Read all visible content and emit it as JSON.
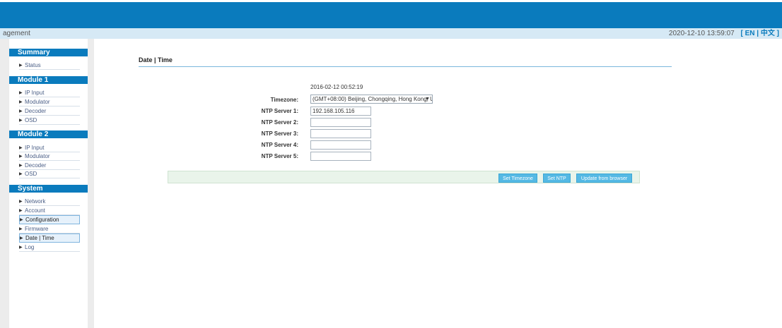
{
  "header": {
    "title_fragment": "agement",
    "datetime": "2020-12-10 13:59:07",
    "lang_switch": "[ EN | 中文 ]"
  },
  "sidebar": {
    "sections": [
      {
        "title": "Summary",
        "items": [
          "Status"
        ]
      },
      {
        "title": "Module 1",
        "items": [
          "IP Input",
          "Modulator",
          "Decoder",
          "OSD"
        ]
      },
      {
        "title": "Module 2",
        "items": [
          "IP Input",
          "Modulator",
          "Decoder",
          "OSD"
        ]
      },
      {
        "title": "System",
        "items": [
          "Network",
          "Account",
          "Configuration",
          "Firmware",
          "Date | Time",
          "Log"
        ]
      }
    ],
    "arrow_glyph": "▶"
  },
  "main": {
    "page_title": "Date | Time",
    "current_time": "2016-02-12 00:52:19",
    "timezone_label": "Timezone:",
    "timezone_value": "(GMT+08:00) Beijing, Chongqing, Hong Kong, U",
    "ntp_labels": [
      "NTP Server 1:",
      "NTP Server 2:",
      "NTP Server 3:",
      "NTP Server 4:",
      "NTP Server 5:"
    ],
    "ntp_values": [
      "192.168.105.116",
      "",
      "",
      "",
      ""
    ],
    "buttons": {
      "set_timezone": "Set Timezone",
      "set_ntp": "Set NTP",
      "update_browser": "Update from browser"
    }
  },
  "colors": {
    "brand_blue": "#0a7bbd",
    "subbar": "#d6e9f5",
    "button": "#55b9e4",
    "action_bar": "#e9f4ea"
  }
}
